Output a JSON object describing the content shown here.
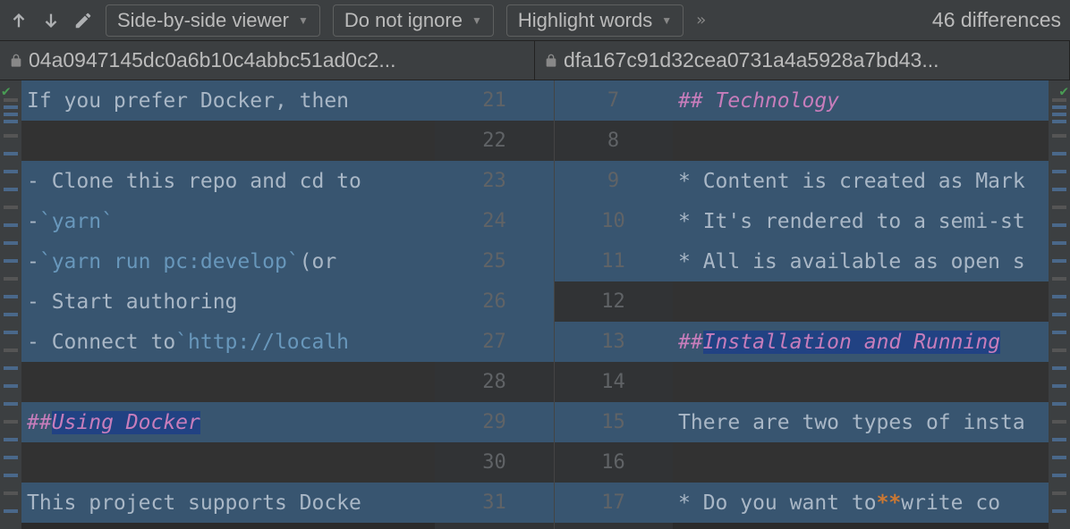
{
  "toolbar": {
    "viewer_mode": "Side-by-side viewer",
    "ignore_mode": "Do not ignore",
    "highlight_mode": "Highlight words",
    "diff_count": "46 differences"
  },
  "files": {
    "left": "04a0947145dc0a6b10c4abbc51ad0c2...",
    "right": "dfa167c91d32cea0731a4a5928a7bd43..."
  },
  "left_lines": [
    {
      "n": 21,
      "bg": "bg-change-left",
      "segs": [
        {
          "t": "If you prefer Docker, then",
          "c": "code-text"
        }
      ]
    },
    {
      "n": 22,
      "bg": "bg-gray",
      "segs": []
    },
    {
      "n": 23,
      "bg": "bg-change-left",
      "segs": [
        {
          "t": "- Clone this repo and cd to",
          "c": "code-text"
        }
      ]
    },
    {
      "n": 24,
      "bg": "bg-change-left",
      "segs": [
        {
          "t": "- ",
          "c": "code-text"
        },
        {
          "t": "`yarn`",
          "c": "backtick"
        }
      ]
    },
    {
      "n": 25,
      "bg": "bg-change-left",
      "segs": [
        {
          "t": "- ",
          "c": "code-text"
        },
        {
          "t": "`yarn run pc:develop`",
          "c": "backtick"
        },
        {
          "t": " (or",
          "c": "code-text"
        }
      ]
    },
    {
      "n": 26,
      "bg": "bg-change-left",
      "segs": [
        {
          "t": "- Start authoring",
          "c": "code-text"
        }
      ]
    },
    {
      "n": 27,
      "bg": "bg-change-left",
      "segs": [
        {
          "t": "- Connect to ",
          "c": "code-text"
        },
        {
          "t": "`http://localh",
          "c": "backtick"
        }
      ]
    },
    {
      "n": 28,
      "bg": "bg-gray",
      "segs": []
    },
    {
      "n": 29,
      "bg": "bg-change-left",
      "segs": [
        {
          "t": "## ",
          "c": "heading"
        },
        {
          "t": "Using Docker",
          "c": "heading heading-hl"
        }
      ]
    },
    {
      "n": 30,
      "bg": "bg-gray",
      "segs": []
    },
    {
      "n": 31,
      "bg": "bg-change-left",
      "segs": [
        {
          "t": "This project supports Docke",
          "c": "code-text"
        }
      ]
    }
  ],
  "right_lines": [
    {
      "n": 7,
      "bg": "bg-change-left",
      "segs": [
        {
          "t": "## Technology",
          "c": "heading"
        }
      ]
    },
    {
      "n": 8,
      "bg": "bg-gray",
      "segs": []
    },
    {
      "n": 9,
      "bg": "bg-change-left",
      "segs": [
        {
          "t": "* Content is created as Mark",
          "c": "code-text"
        }
      ]
    },
    {
      "n": 10,
      "bg": "bg-change-left",
      "segs": [
        {
          "t": "* It's rendered to a semi-st",
          "c": "code-text"
        }
      ]
    },
    {
      "n": 11,
      "bg": "bg-change-left",
      "segs": [
        {
          "t": "* All is available as open s",
          "c": "code-text"
        }
      ]
    },
    {
      "n": 12,
      "bg": "bg-gray",
      "segs": []
    },
    {
      "n": 13,
      "bg": "bg-change-left",
      "segs": [
        {
          "t": "## ",
          "c": "heading"
        },
        {
          "t": "Installation and Running",
          "c": "heading heading-hl"
        }
      ]
    },
    {
      "n": 14,
      "bg": "bg-gray",
      "segs": []
    },
    {
      "n": 15,
      "bg": "bg-change-left",
      "segs": [
        {
          "t": "There are two types of insta",
          "c": "code-text"
        }
      ]
    },
    {
      "n": 16,
      "bg": "bg-gray",
      "segs": []
    },
    {
      "n": 17,
      "bg": "bg-change-left",
      "segs": [
        {
          "t": "* Do you want to ",
          "c": "code-text"
        },
        {
          "t": "**",
          "c": "bold-orange"
        },
        {
          "t": "write co",
          "c": "code-text"
        }
      ]
    }
  ],
  "gutter": [
    {
      "l": 21,
      "r": 7,
      "lc": "gutter-change-blue",
      "rc": "gutter-change-blue"
    },
    {
      "l": 22,
      "r": 8,
      "lc": "",
      "rc": ""
    },
    {
      "l": 23,
      "r": 9,
      "lc": "gutter-change-blue",
      "rc": "gutter-change-blue"
    },
    {
      "l": 24,
      "r": 10,
      "lc": "gutter-change-blue",
      "rc": "gutter-change-blue"
    },
    {
      "l": 25,
      "r": 11,
      "lc": "gutter-change-blue",
      "rc": "gutter-change-blue"
    },
    {
      "l": 26,
      "r": 12,
      "lc": "gutter-change-blue",
      "rc": ""
    },
    {
      "l": 27,
      "r": 13,
      "lc": "gutter-change-blue",
      "rc": "gutter-change-blue"
    },
    {
      "l": 28,
      "r": 14,
      "lc": "",
      "rc": ""
    },
    {
      "l": 29,
      "r": 15,
      "lc": "gutter-change-blue",
      "rc": "gutter-change-blue"
    },
    {
      "l": 30,
      "r": 16,
      "lc": "",
      "rc": ""
    },
    {
      "l": 31,
      "r": 17,
      "lc": "gutter-change-blue",
      "rc": "gutter-change-blue"
    }
  ]
}
